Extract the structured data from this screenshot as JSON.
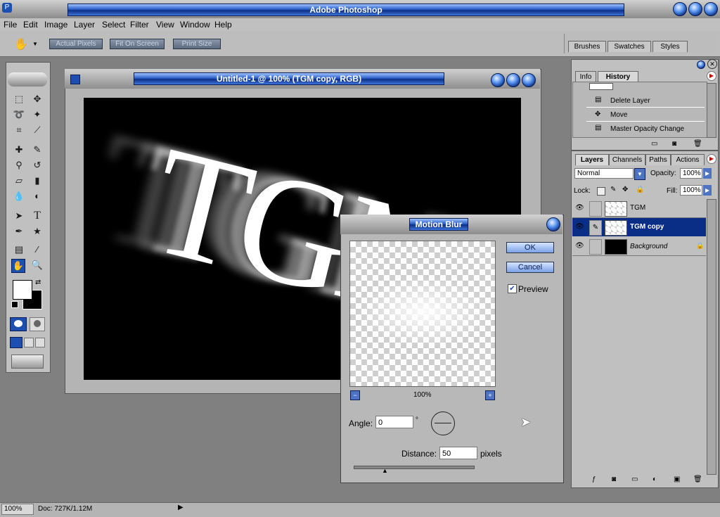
{
  "app": {
    "title": "Adobe Photoshop"
  },
  "menu": [
    "File",
    "Edit",
    "Image",
    "Layer",
    "Select",
    "Filter",
    "View",
    "Window",
    "Help"
  ],
  "options_bar": {
    "buttons": [
      "Actual Pixels",
      "Fit On Screen",
      "Print Size"
    ]
  },
  "palette_well": {
    "tabs": [
      "Brushes",
      "Swatches",
      "Styles"
    ]
  },
  "document": {
    "title": "Untitled-1 @ 100% (TGM copy, RGB)",
    "canvas_text": "TGM"
  },
  "history_panel": {
    "tabs": [
      "Info",
      "History"
    ],
    "items": [
      "Delete Layer",
      "Move",
      "Master Opacity Change"
    ]
  },
  "layers_panel": {
    "tabs": [
      "Layers",
      "Channels",
      "Paths",
      "Actions"
    ],
    "blend_mode": "Normal",
    "opacity_label": "Opacity:",
    "opacity_value": "100%",
    "lock_label": "Lock:",
    "fill_label": "Fill:",
    "fill_value": "100%",
    "layers": [
      {
        "name": "TGM",
        "selected": false
      },
      {
        "name": "TGM copy",
        "selected": true
      },
      {
        "name": "Background",
        "selected": false
      }
    ]
  },
  "dialog": {
    "title": "Motion Blur",
    "ok_label": "OK",
    "cancel_label": "Cancel",
    "preview_label": "Preview",
    "preview_checked": true,
    "zoom": "100%",
    "angle_label": "Angle:",
    "angle_value": "0",
    "angle_unit": "°",
    "distance_label": "Distance:",
    "distance_value": "50",
    "distance_unit": "pixels"
  },
  "status_bar": {
    "zoom": "100%",
    "doc_size": "Doc: 727K/1.12M"
  },
  "colors": {
    "accent_blue": "#1c4fb0",
    "selected_layer": "#0a2e86",
    "workspace": "#808080"
  }
}
